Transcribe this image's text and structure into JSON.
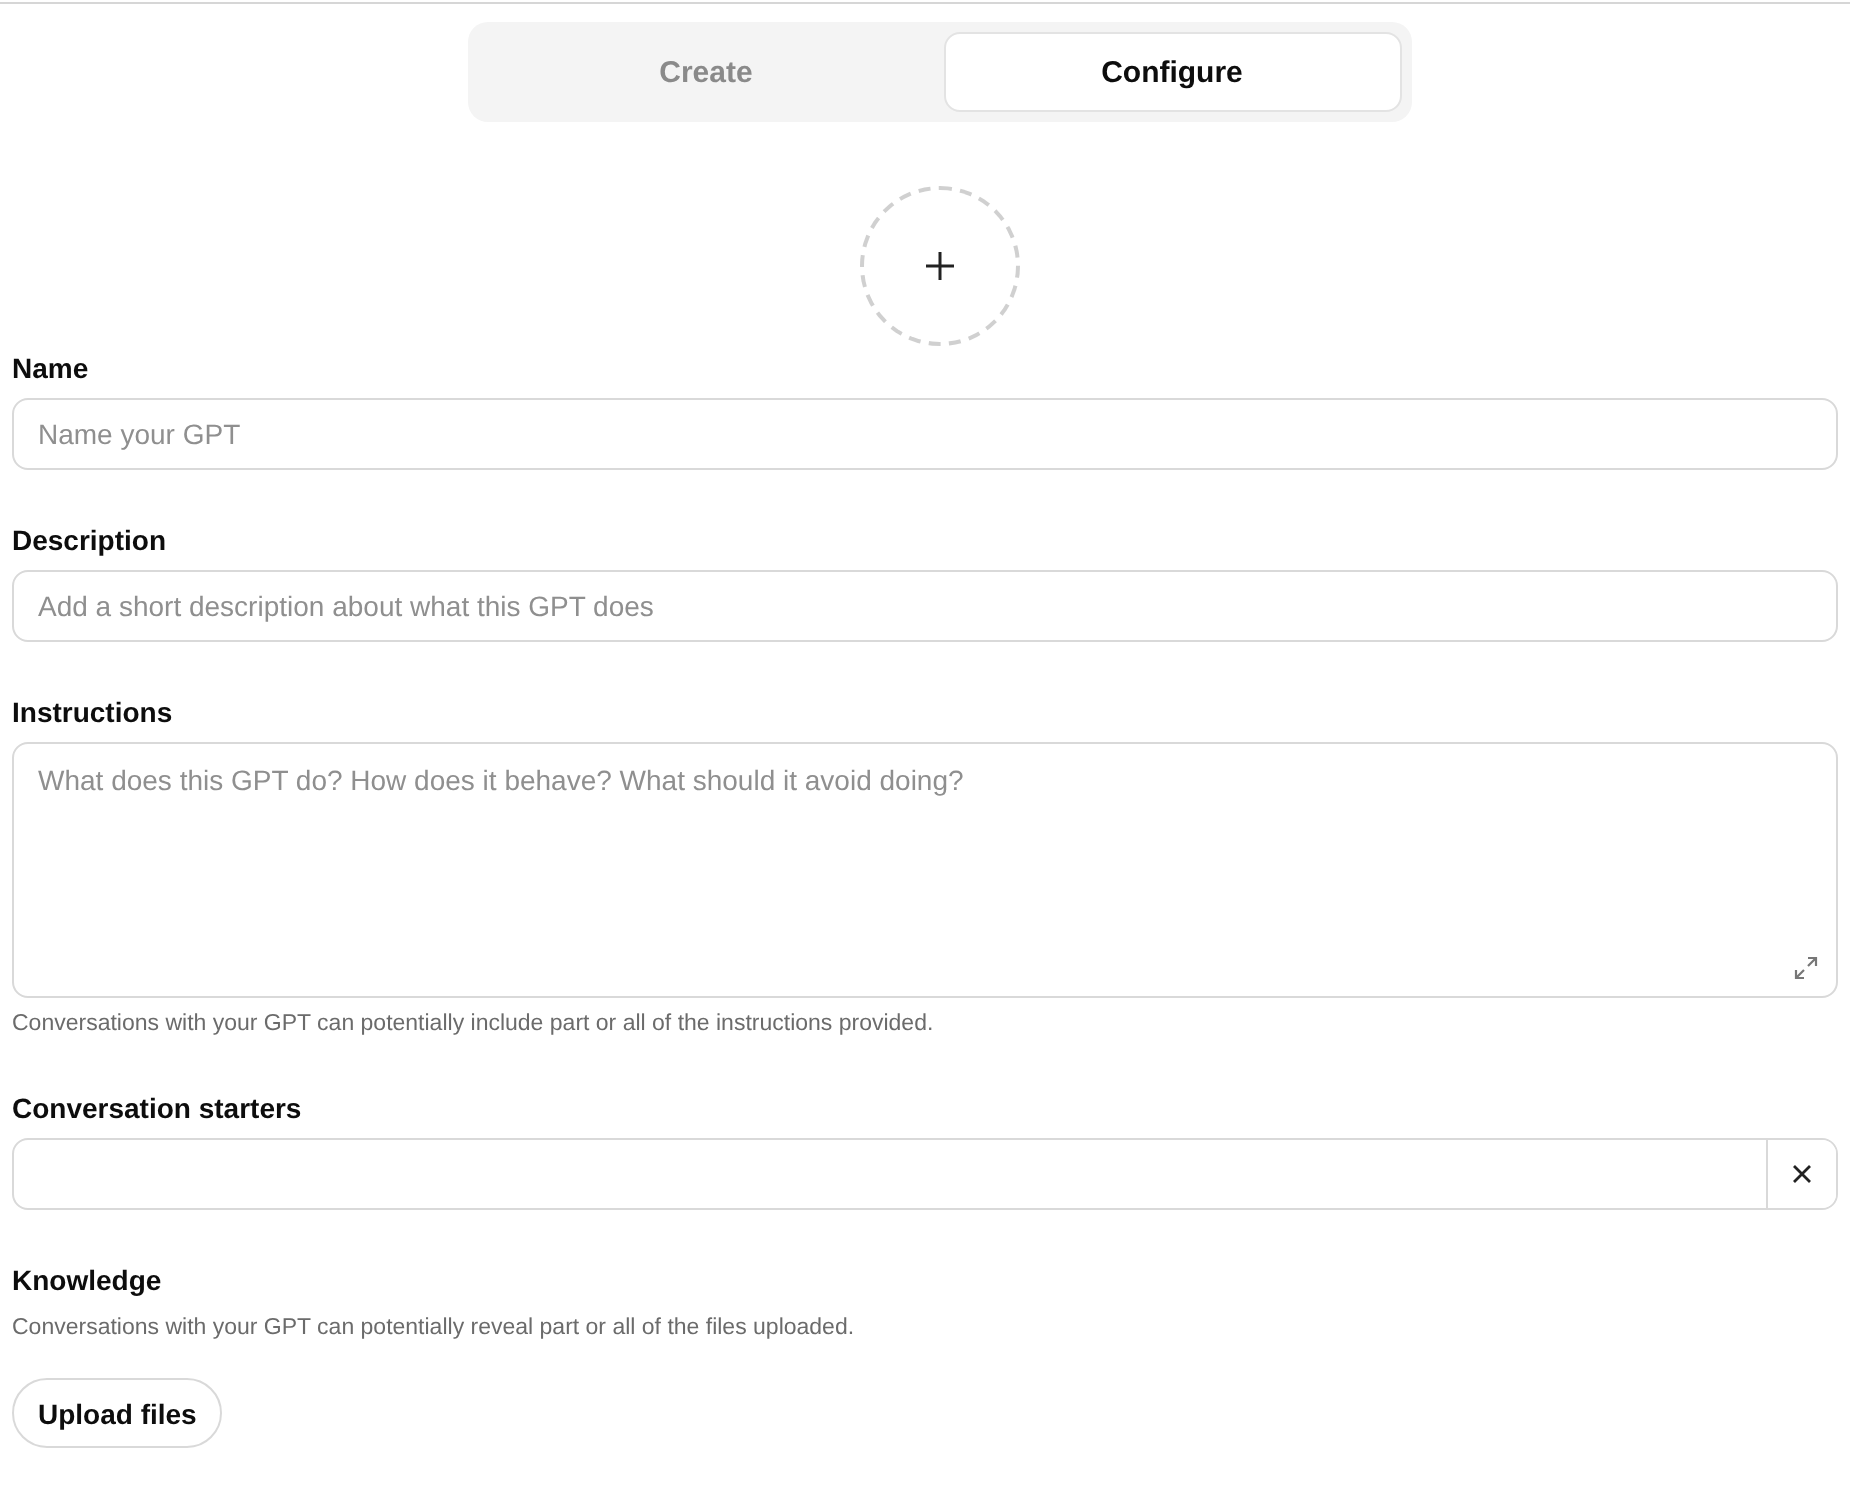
{
  "tabs": [
    {
      "label": "Create",
      "selected": false
    },
    {
      "label": "Configure",
      "selected": true
    }
  ],
  "fields": [
    {
      "kind": "input",
      "label": "Name",
      "placeholder": "Name your GPT"
    },
    {
      "kind": "input",
      "label": "Description",
      "placeholder": "Add a short description about what this GPT does"
    },
    {
      "kind": "textarea",
      "label": "Instructions",
      "placeholder": "What does this GPT do? How does it behave? What should it avoid doing?",
      "hint": "Conversations with your GPT can potentially include part or all of the instructions provided."
    },
    {
      "kind": "starter",
      "label": "Conversation starters"
    },
    {
      "kind": "upload",
      "label": "Knowledge",
      "hint": "Conversations with your GPT can potentially reveal part or all of the files uploaded.",
      "button": "Upload files"
    }
  ]
}
